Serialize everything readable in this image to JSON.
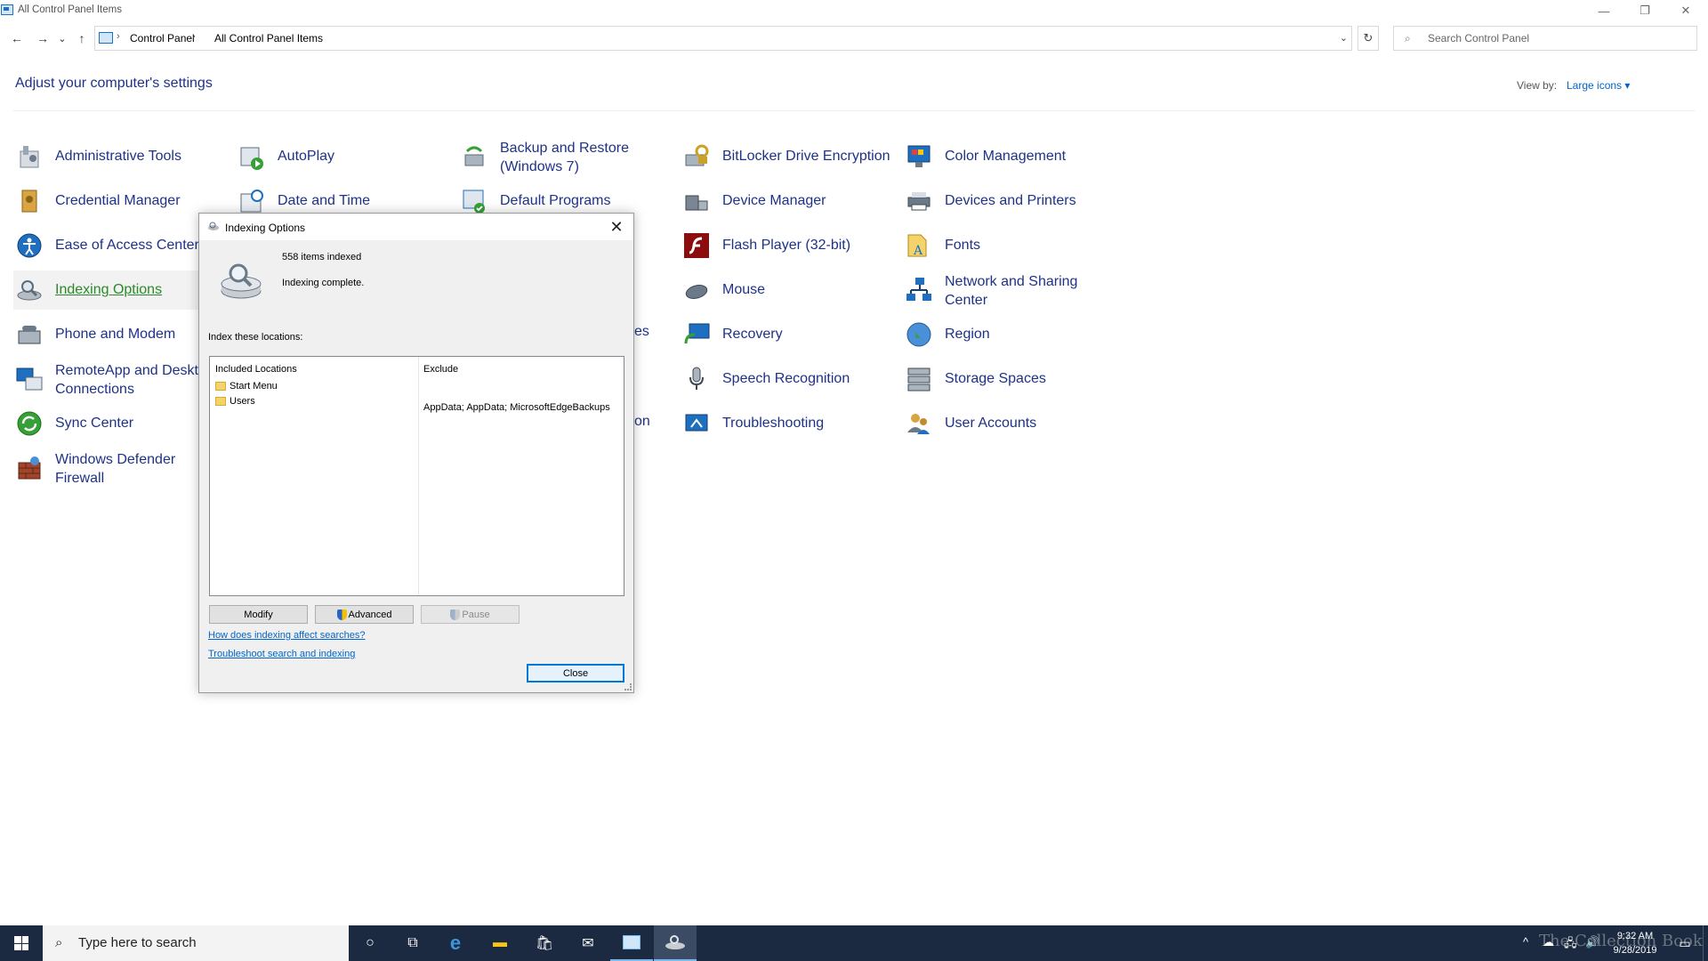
{
  "window": {
    "title": "All Control Panel Items",
    "minimize_glyph": "—",
    "restore_glyph": "❐",
    "close_glyph": "✕"
  },
  "nav": {
    "back_glyph": "←",
    "forward_glyph": "→",
    "recent_glyph": "⌄",
    "up_glyph": "↑",
    "breadcrumb": [
      "Control Panel",
      "All Control Panel Items"
    ],
    "separator": "›",
    "dropdown_glyph": "⌄",
    "refresh_glyph": "↻"
  },
  "search": {
    "placeholder": "Search Control Panel",
    "glyph": "⌕"
  },
  "header": {
    "title": "Adjust your computer's settings",
    "view_by_label": "View by:",
    "view_by_value": "Large icons ▾"
  },
  "items": [
    {
      "label": "Administrative Tools",
      "icon": "admin-tools-icon"
    },
    {
      "label": "AutoPlay",
      "icon": "autoplay-icon"
    },
    {
      "label": "Backup and Restore",
      "label2": "(Windows 7)",
      "icon": "backup-icon"
    },
    {
      "label": "BitLocker Drive Encryption",
      "icon": "bitlocker-icon"
    },
    {
      "label": "Color Management",
      "icon": "color-management-icon"
    },
    {
      "label": "Credential Manager",
      "icon": "credential-icon"
    },
    {
      "label": "Date and Time",
      "icon": "date-time-icon"
    },
    {
      "label": "Default Programs",
      "icon": "default-programs-icon"
    },
    {
      "label": "Device Manager",
      "icon": "device-manager-icon"
    },
    {
      "label": "Devices and Printers",
      "icon": "printer-icon"
    },
    {
      "label": "Ease of Access Center",
      "icon": "ease-of-access-icon"
    },
    {
      "label": "Flash Player (32-bit)",
      "icon": "flash-icon"
    },
    {
      "label": "Fonts",
      "icon": "fonts-icon"
    },
    {
      "label": "Indexing Options",
      "icon": "indexing-icon"
    },
    {
      "label": "Mouse",
      "icon": "mouse-icon"
    },
    {
      "label": "Network and Sharing",
      "label2": "Center",
      "icon": "network-icon"
    },
    {
      "label": "Phone and Modem",
      "icon": "phone-icon"
    },
    {
      "label": "Recovery",
      "icon": "recovery-icon"
    },
    {
      "label": "Region",
      "icon": "region-icon"
    },
    {
      "label": "RemoteApp and Deskto",
      "label2": "Connections",
      "icon": "remoteapp-icon"
    },
    {
      "label": "Speech Recognition",
      "icon": "microphone-icon"
    },
    {
      "label": "Storage Spaces",
      "icon": "storage-icon"
    },
    {
      "label": "Sync Center",
      "icon": "sync-icon"
    },
    {
      "label": "Troubleshooting",
      "icon": "troubleshoot-icon"
    },
    {
      "label": "User Accounts",
      "icon": "users-icon"
    },
    {
      "label": "Windows Defender",
      "label2": "Firewall",
      "icon": "firewall-icon"
    },
    {
      "label": "es",
      "icon": ""
    },
    {
      "label": "on",
      "icon": ""
    }
  ],
  "dialog": {
    "title": "Indexing Options",
    "close_glyph": "✕",
    "items_indexed": "558 items indexed",
    "status": "Indexing complete.",
    "locations_label": "Index these locations:",
    "col_included": "Included Locations",
    "col_exclude": "Exclude",
    "locations": [
      "Start Menu",
      "Users"
    ],
    "users_exclude": "AppData; AppData; MicrosoftEdgeBackups",
    "buttons": {
      "modify": "Modify",
      "advanced": "Advanced",
      "pause": "Pause",
      "close": "Close"
    },
    "links": {
      "how": "How does indexing affect searches?",
      "troubleshoot": "Troubleshoot search and indexing"
    }
  },
  "taskbar": {
    "search_placeholder": "Type here to search",
    "search_glyph": "⌕",
    "cortana_glyph": "○",
    "taskview_glyph": "⧉",
    "edge_glyph": "e",
    "explorer_glyph": "▬",
    "store_glyph": "🛍",
    "mail_glyph": "✉",
    "tray_chevron": "^",
    "tray_onedrive": "☁",
    "tray_network": "🖧",
    "tray_volume": "🔊",
    "time": "9:32 AM",
    "date": "9/28/2019",
    "watermark": "The Collection Book"
  },
  "colors": {
    "link": "#0066cc",
    "item_text": "#1e3287",
    "taskbar": "#1b2a40",
    "accent": "#0078d7"
  }
}
